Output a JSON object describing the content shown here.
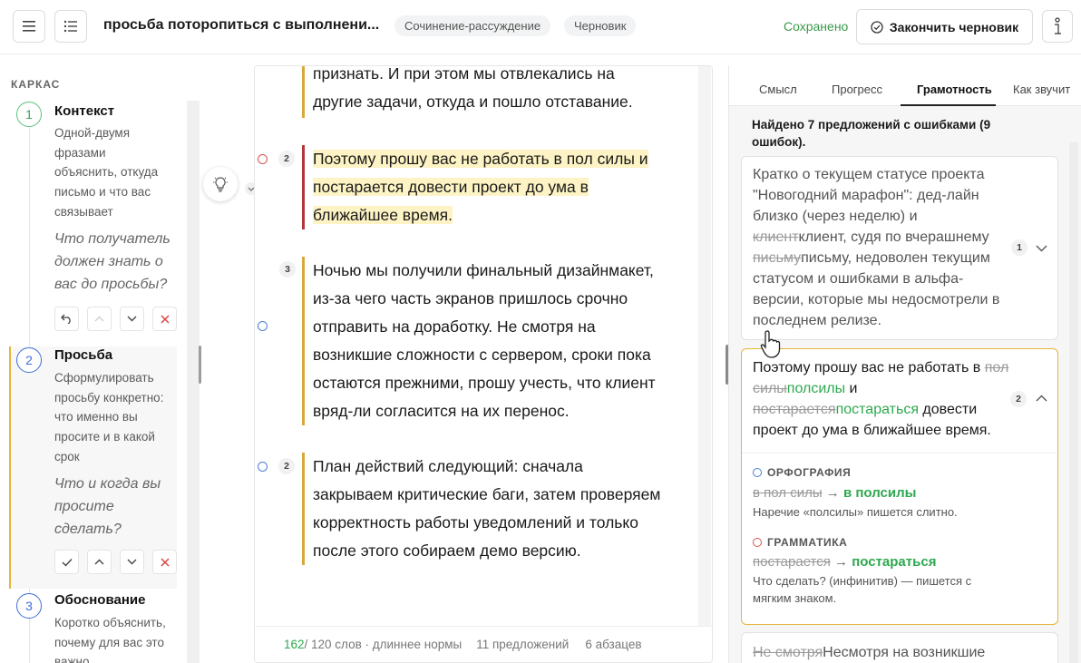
{
  "topbar": {
    "title": "просьба поторопиться с выполнени...",
    "chips": [
      "Сочинение-рассуждение",
      "Черновик"
    ],
    "saved": "Сохранено",
    "finish_label": "Закончить черновик"
  },
  "outline": {
    "label": "КАРКАС",
    "steps": [
      {
        "num": "1",
        "title": "Контекст",
        "desc": "Одной-двумя фразами объяснить, откуда письмо и что вас связывает",
        "question": "Что получатель должен знать о вас до просьбы?"
      },
      {
        "num": "2",
        "title": "Просьба",
        "desc": "Сформулировать просьбу конкретно: что именно вы просите и в какой срок",
        "question": "Что и когда вы просите сделать?"
      },
      {
        "num": "3",
        "title": "Обоснование",
        "desc": "Коротко объяснить, почему для вас это важно"
      }
    ]
  },
  "editor": {
    "para0": "признать. И при этом мы отвлекались на другие задачи, откуда и пошло отставание.",
    "para1": "Поэтому прошу вас не работать в пол силы и постарается довести проект до ума в ближайшее время.",
    "para1_num": "2",
    "para2": "Ночью мы получили финальный дизайнмакет, из-за чего часть экранов пришлось срочно отправить на доработку. Не смотря на возникшие сложности с сервером, сроки пока остаются прежними, прошу учесть, что клиент вряд-ли согласится на их перенос.",
    "para2_num": "3",
    "para3": "План действий следующий: сначала закрываем критические баги, затем проверяем корректность работы уведомлений и только после этого собираем демо версию.",
    "para3_num": "2",
    "footer": {
      "words_current": "162",
      "words_rest": " / 120 слов · длиннее нормы",
      "sentences": "11 предложений",
      "paragraphs": "6 абзацев"
    }
  },
  "panel": {
    "tabs": [
      "Смысл",
      "Прогресс",
      "Грамотность",
      "Как звучит"
    ],
    "active_tab": "Грамотность",
    "summary": "Найдено 7 предложений с ошибками (9 ошибок).",
    "card1": {
      "t1": "Кратко о текущем статусе проекта \"Новогодний марафон\": дед-лайн близко (через неделю) и ",
      "s1": "клиент",
      "f1": "клиент",
      "t2": ", судя по вчерашнему ",
      "s2": "письму",
      "f2": "письму",
      "t3": ", недоволен текущим статусом и ошибками в альфа-версии, которые мы недосмотрели в последнем релизе.",
      "count": "1"
    },
    "card2": {
      "t1": "Поэтому прошу вас не работать в ",
      "s1": "пол силы",
      "f1": "полсилы",
      "t2": " и ",
      "s2": "постарается",
      "f2": "постараться",
      "t3": " довести проект до ума в ближайшее время.",
      "count": "2",
      "issue1": {
        "type": "ОРФОГРАФИЯ",
        "from": "в пол силы",
        "arrow": " → ",
        "to": "в полсилы",
        "note": "Наречие «полсилы» пишется слитно."
      },
      "issue2": {
        "type": "ГРАММАТИКА",
        "from": "постарается",
        "arrow": " → ",
        "to": "постараться",
        "note": "Что сделать? (инфинитив) — пишется с мягким знаком."
      }
    },
    "card3": {
      "s1": "Не смотря",
      "t1": "Несмотря на возникшие"
    }
  },
  "colors": {
    "accent_green": "#2ea84f",
    "highlight": "#fdf3c4",
    "para_bar": "#d8a83a",
    "active_card": "#e5b53a"
  }
}
